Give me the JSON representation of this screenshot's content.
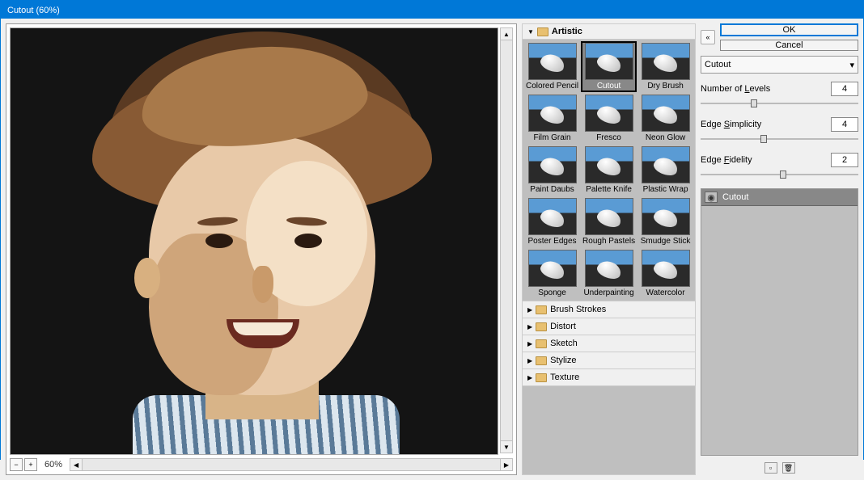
{
  "window": {
    "title": "Cutout (60%)"
  },
  "zoom": {
    "level": "60%"
  },
  "gallery": {
    "open_category": "Artistic",
    "thumbs": [
      {
        "label": "Colored Pencil"
      },
      {
        "label": "Cutout",
        "selected": true
      },
      {
        "label": "Dry Brush"
      },
      {
        "label": "Film Grain"
      },
      {
        "label": "Fresco"
      },
      {
        "label": "Neon Glow"
      },
      {
        "label": "Paint Daubs"
      },
      {
        "label": "Palette Knife"
      },
      {
        "label": "Plastic Wrap"
      },
      {
        "label": "Poster Edges"
      },
      {
        "label": "Rough Pastels"
      },
      {
        "label": "Smudge Stick"
      },
      {
        "label": "Sponge"
      },
      {
        "label": "Underpainting"
      },
      {
        "label": "Watercolor"
      }
    ],
    "closed_categories": [
      "Brush Strokes",
      "Distort",
      "Sketch",
      "Stylize",
      "Texture"
    ]
  },
  "buttons": {
    "ok": "OK",
    "cancel": "Cancel"
  },
  "filter_select": {
    "value": "Cutout"
  },
  "params": {
    "levels": {
      "label_pre": "Number of ",
      "u": "L",
      "label_post": "evels",
      "value": "4",
      "pos": 32
    },
    "simplicity": {
      "label_pre": "Edge ",
      "u": "S",
      "label_post": "implicity",
      "value": "4",
      "pos": 38
    },
    "fidelity": {
      "label_pre": "Edge ",
      "u": "F",
      "label_post": "idelity",
      "value": "2",
      "pos": 50
    }
  },
  "layers": {
    "active": "Cutout"
  }
}
